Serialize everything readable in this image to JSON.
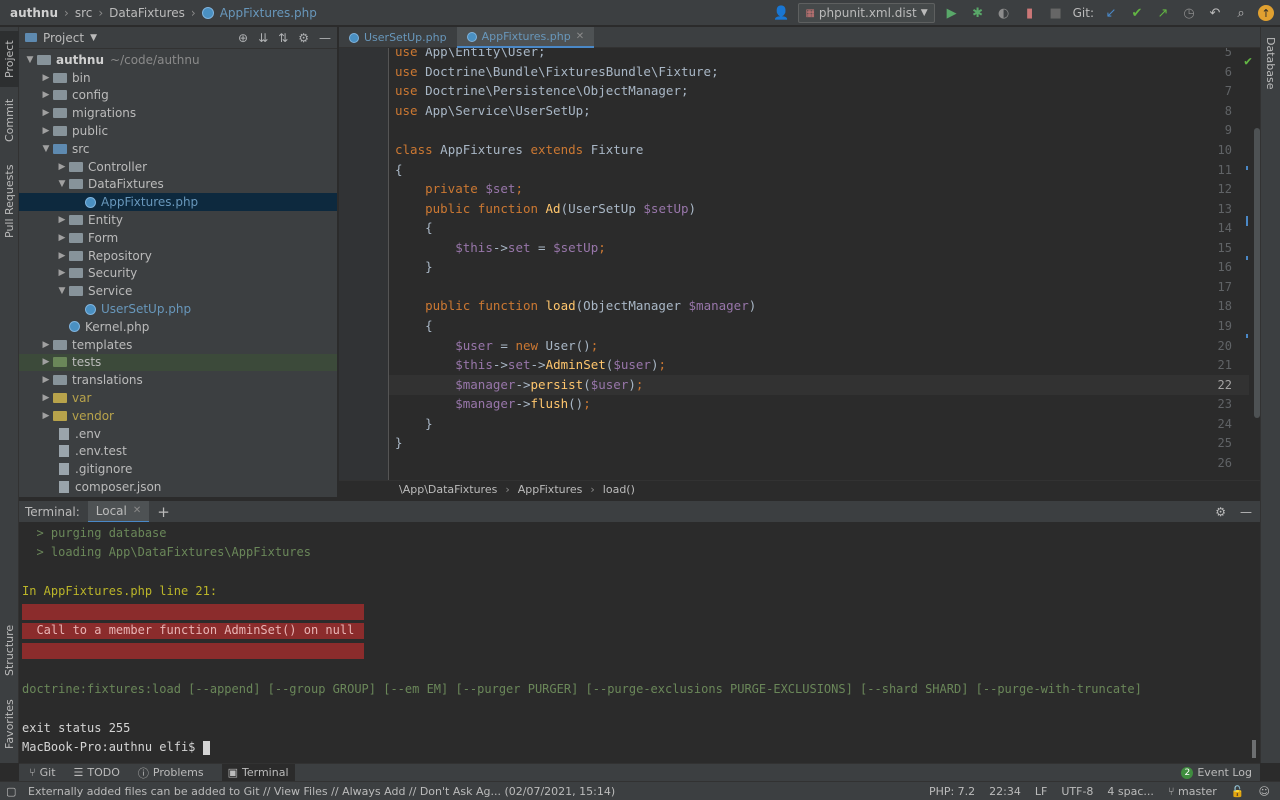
{
  "navbar": {
    "crumbs": [
      "authnu",
      "src",
      "DataFixtures",
      "AppFixtures.php"
    ],
    "run_config": "phpunit.xml.dist",
    "git_label": "Git:"
  },
  "left_stripe": {
    "project": "Project",
    "commit": "Commit",
    "pull_requests": "Pull Requests",
    "structure": "Structure",
    "favorites": "Favorites"
  },
  "right_stripe": {
    "database": "Database"
  },
  "project": {
    "title": "Project",
    "root": {
      "name": "authnu",
      "path": "~/code/authnu"
    },
    "items": [
      {
        "label": "bin",
        "type": "folder"
      },
      {
        "label": "config",
        "type": "folder"
      },
      {
        "label": "migrations",
        "type": "folder"
      },
      {
        "label": "public",
        "type": "folder"
      },
      {
        "label": "src",
        "type": "folder-open"
      },
      {
        "label": "Controller",
        "type": "folder"
      },
      {
        "label": "DataFixtures",
        "type": "folder-open"
      },
      {
        "label": "AppFixtures.php",
        "type": "php"
      },
      {
        "label": "Entity",
        "type": "folder"
      },
      {
        "label": "Form",
        "type": "folder"
      },
      {
        "label": "Repository",
        "type": "folder"
      },
      {
        "label": "Security",
        "type": "folder"
      },
      {
        "label": "Service",
        "type": "folder-open"
      },
      {
        "label": "UserSetUp.php",
        "type": "php"
      },
      {
        "label": "Kernel.php",
        "type": "php"
      },
      {
        "label": "templates",
        "type": "folder"
      },
      {
        "label": "tests",
        "type": "folder"
      },
      {
        "label": "translations",
        "type": "folder"
      },
      {
        "label": "var",
        "type": "folder"
      },
      {
        "label": "vendor",
        "type": "folder"
      },
      {
        "label": ".env",
        "type": "file"
      },
      {
        "label": ".env.test",
        "type": "file"
      },
      {
        "label": ".gitignore",
        "type": "file"
      },
      {
        "label": "composer.json",
        "type": "file"
      }
    ]
  },
  "editor": {
    "tabs": [
      "UserSetUp.php",
      "AppFixtures.php"
    ],
    "line_numbers": [
      "5",
      "6",
      "7",
      "8",
      "9",
      "10",
      "11",
      "12",
      "13",
      "14",
      "15",
      "16",
      "17",
      "18",
      "19",
      "20",
      "21",
      "22",
      "23",
      "24",
      "25",
      "26"
    ],
    "current_line": "22",
    "breadcrumb": [
      "\\App\\DataFixtures",
      "AppFixtures",
      "load()"
    ]
  },
  "terminal": {
    "label": "Terminal:",
    "tab": "Local",
    "lines": {
      "l1": "  > purging database",
      "l2": "  > loading App\\DataFixtures\\AppFixtures",
      "l3": "In AppFixtures.php line 21:",
      "l4": "  Call to a member function AdminSet() on null",
      "l5": "doctrine:fixtures:load [--append] [--group GROUP] [--em EM] [--purger PURGER] [--purge-exclusions PURGE-EXCLUSIONS] [--shard SHARD] [--purge-with-truncate]",
      "l6": "exit status 255",
      "l7": "MacBook-Pro:authnu elfi$ "
    }
  },
  "tool_tabs": {
    "git": "Git",
    "todo": "TODO",
    "problems": "Problems",
    "terminal": "Terminal",
    "event_log": "Event Log"
  },
  "status": {
    "message": "Externally added files can be added to Git // View Files // Always Add // Don't Ask Ag... (02/07/2021, 15:14)",
    "php": "PHP: 7.2",
    "position": "22:34",
    "line_sep": "LF",
    "encoding": "UTF-8",
    "indent": "4 spac...",
    "branch": "master"
  },
  "colors": {
    "accent": "#4a88c7",
    "error_bg": "#8b2c2c",
    "keyword": "#cc7832",
    "variable": "#9876aa",
    "function": "#ffc66d"
  }
}
